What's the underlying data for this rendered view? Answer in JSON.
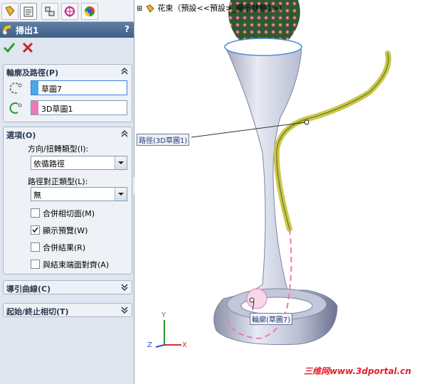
{
  "tree_root": "花束（預設<<預設>_顯示狀態1>）",
  "title": "掃出1",
  "help": "?",
  "profile_group": {
    "title": "輪廓及路徑(P)",
    "profile_value": "草圖7",
    "path_value": "3D草圖1",
    "profile_color": "#4aa6e8",
    "path_color": "#ee78b6"
  },
  "options_group": {
    "title": "選項(O)",
    "orientation_label": "方向/扭轉類型(I):",
    "orientation_value": "依循路徑",
    "alignment_label": "路徑對正類型(L):",
    "alignment_value": "無",
    "checkboxes": [
      {
        "label": "合併相切面(M)",
        "checked": false
      },
      {
        "label": "顯示預覽(W)",
        "checked": true
      },
      {
        "label": "合併結果(R)",
        "checked": false
      },
      {
        "label": "與結束端面對齊(A)",
        "checked": false
      }
    ]
  },
  "guide_group": {
    "title": "導引曲線(C)"
  },
  "tangency_group": {
    "title": "起始/終止相切(T)"
  },
  "callouts": {
    "path": "路徑(3D草圖1)",
    "profile": "輪廓(草圖7)"
  },
  "triad": {
    "x": "X",
    "y": "Y",
    "z": "Z"
  },
  "watermark": "三维网www.3dportal.cn",
  "colors": {
    "accent": "#3f5f86",
    "model": "#d4d8ea",
    "ok": "#2fa12f",
    "cancel": "#d02020"
  }
}
